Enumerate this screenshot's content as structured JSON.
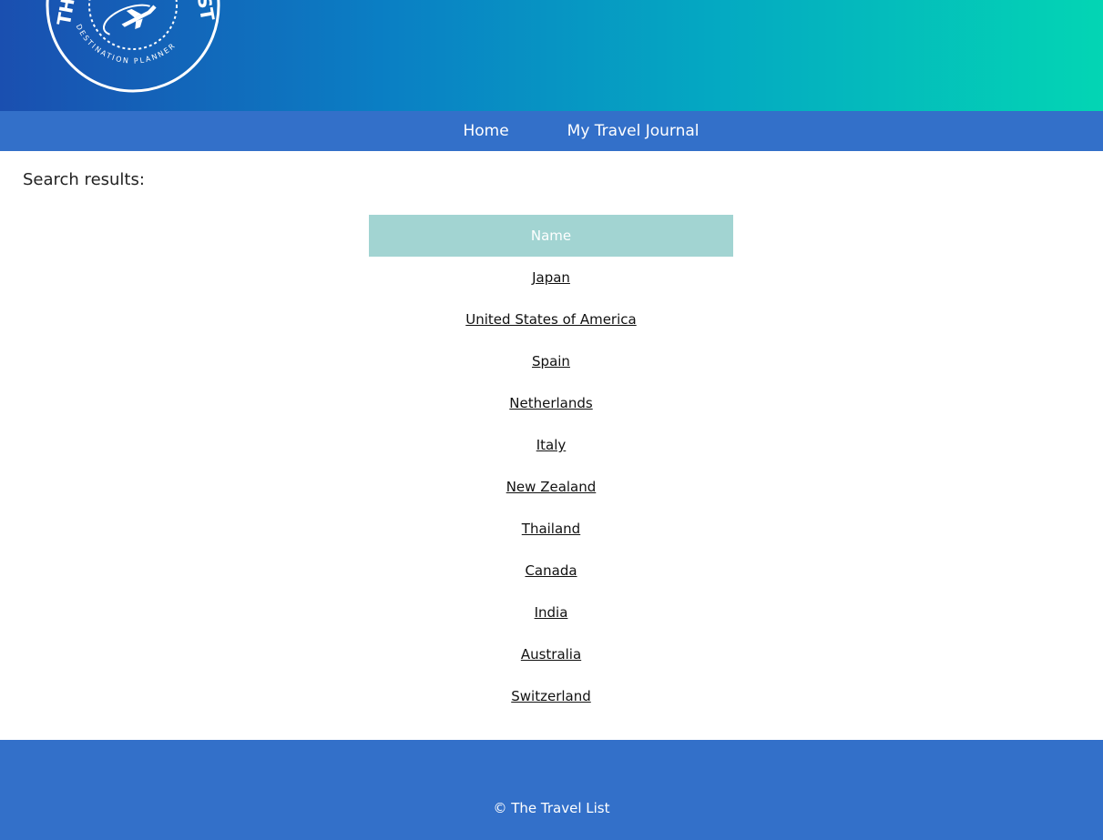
{
  "header": {
    "logo": {
      "icon": "airplane-icon",
      "text_top": "THE TRAVEL LIST",
      "text_bottom": "DESTINATION PLANNER"
    },
    "colors": {
      "gradient_start": "#1a4fb0",
      "gradient_end": "#03d5b4"
    }
  },
  "nav": {
    "items": [
      {
        "label": "Home"
      },
      {
        "label": "My Travel Journal"
      }
    ],
    "color": "#3370c9"
  },
  "main": {
    "heading": "Search results:",
    "table": {
      "column_header": "Name",
      "header_color": "#a2d4d2",
      "rows": [
        "Japan",
        "United States of America",
        "Spain",
        "Netherlands",
        "Italy",
        "New Zealand",
        "Thailand",
        "Canada",
        "India",
        "Australia",
        "Switzerland"
      ]
    }
  },
  "footer": {
    "copyright": "© The Travel List"
  }
}
